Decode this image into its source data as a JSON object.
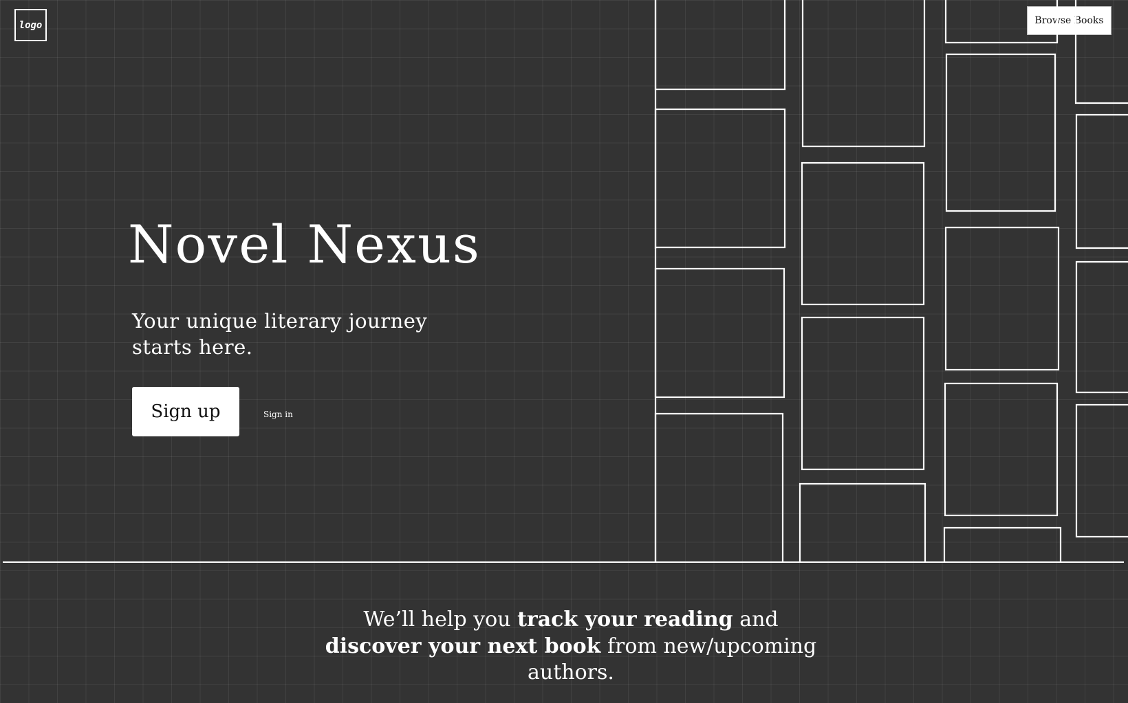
{
  "header": {
    "logo_text": "logo",
    "browse_button_label": "Browse Books"
  },
  "hero": {
    "title": "Novel Nexus",
    "tagline_line1": "Your unique literary journey",
    "tagline_line2": "starts here.",
    "signup_label": "Sign up",
    "signin_label": "Sign in"
  },
  "mission": {
    "part1": "We’ll help you ",
    "bold1": "track your reading",
    "part2": " and",
    "bold2": "discover your next book",
    "part3": " from new/upcoming",
    "part4": "authors."
  },
  "colors": {
    "background": "#333333",
    "foreground": "#ffffff",
    "grid": "rgba(255,255,255,0.07)"
  }
}
